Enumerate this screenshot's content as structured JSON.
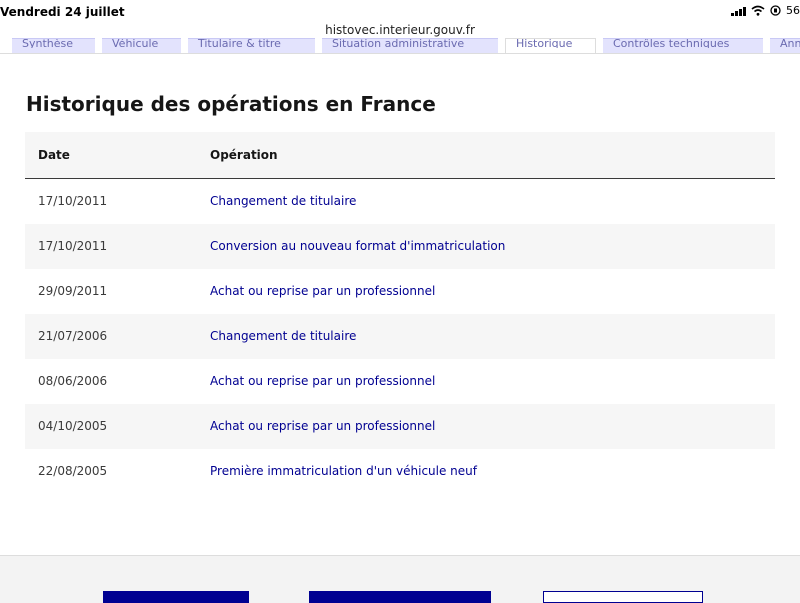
{
  "status_bar": {
    "time": "Vendredi 24 juillet",
    "battery": "56"
  },
  "browser": {
    "url": "histovec.interieur.gouv.fr"
  },
  "tabs": [
    {
      "label": "Synthèse"
    },
    {
      "label": "Véhicule"
    },
    {
      "label": "Titulaire & titre"
    },
    {
      "label": "Situation administrative"
    },
    {
      "label": "Historique"
    },
    {
      "label": "Contrôles techniques"
    },
    {
      "label": "Annonce"
    }
  ],
  "section": {
    "title": "Historique des opérations en France"
  },
  "table": {
    "headers": {
      "date": "Date",
      "operation": "Opération"
    },
    "rows": [
      {
        "date": "17/10/2011",
        "operation": "Changement de titulaire"
      },
      {
        "date": "17/10/2011",
        "operation": "Conversion au nouveau format d'immatriculation"
      },
      {
        "date": "29/09/2011",
        "operation": "Achat ou reprise par un professionnel"
      },
      {
        "date": "21/07/2006",
        "operation": "Changement de titulaire"
      },
      {
        "date": "08/06/2006",
        "operation": "Achat ou reprise par un professionnel"
      },
      {
        "date": "04/10/2005",
        "operation": "Achat ou reprise par un professionnel"
      },
      {
        "date": "22/08/2005",
        "operation": "Première immatriculation d'un véhicule neuf"
      }
    ]
  },
  "colors": {
    "accent": "#000091",
    "row_alt": "#f6f6f6",
    "tab_bg": "#e3e3fd"
  }
}
